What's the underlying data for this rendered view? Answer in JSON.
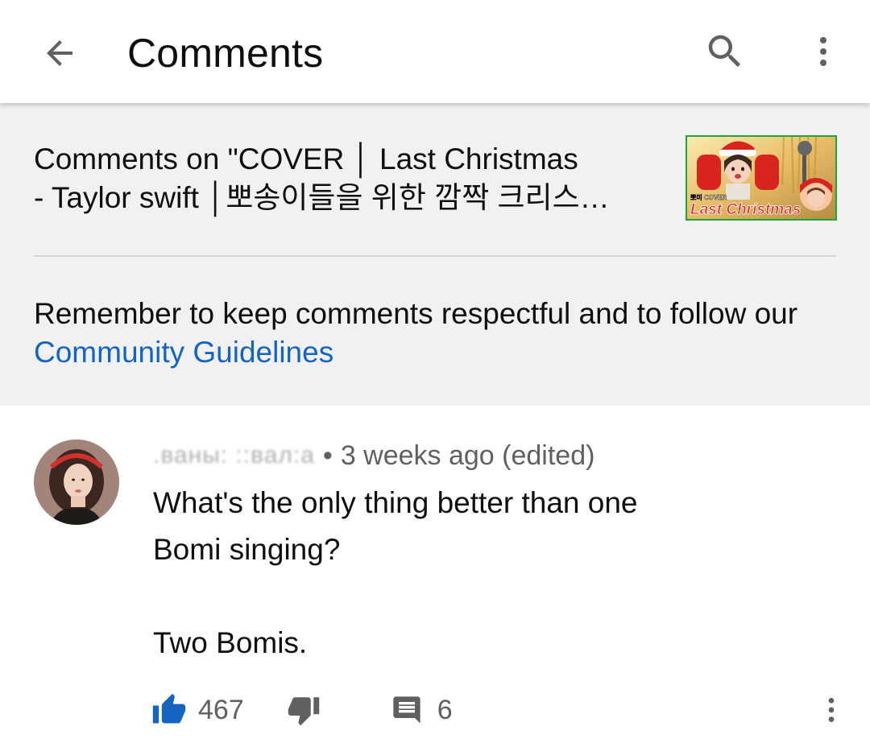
{
  "header": {
    "title": "Comments",
    "back_icon": "arrow-back-icon",
    "search_icon": "search-icon",
    "more_icon": "more-vert-icon"
  },
  "video": {
    "title_line1": "Comments on \"COVER │ Last Christmas",
    "title_line2": "- Taylor swift │뽀송이들을 위한 깜짝 크리스…",
    "thumbnail_caption": "Last Christmas",
    "thumbnail_subcaption": "뽀미 COVER"
  },
  "notice": {
    "text": "Remember to keep comments respectful and to follow our ",
    "link": "Community Guidelines"
  },
  "comment": {
    "author": ".ваны: ::вал:а",
    "separator": "•",
    "time": "3 weeks ago (edited)",
    "text": "What's the only thing better than one\nBomi singing?\n\nTwo Bomis.",
    "likes": "467",
    "replies": "6",
    "like_icon": "thumb-up-icon",
    "dislike_icon": "thumb-down-icon",
    "reply_icon": "comment-icon",
    "more_icon": "more-vert-icon"
  },
  "colors": {
    "link": "#1565c0",
    "like_active": "#1565c0",
    "panel_bg": "#f1f1f1",
    "secondary_text": "#606060"
  }
}
